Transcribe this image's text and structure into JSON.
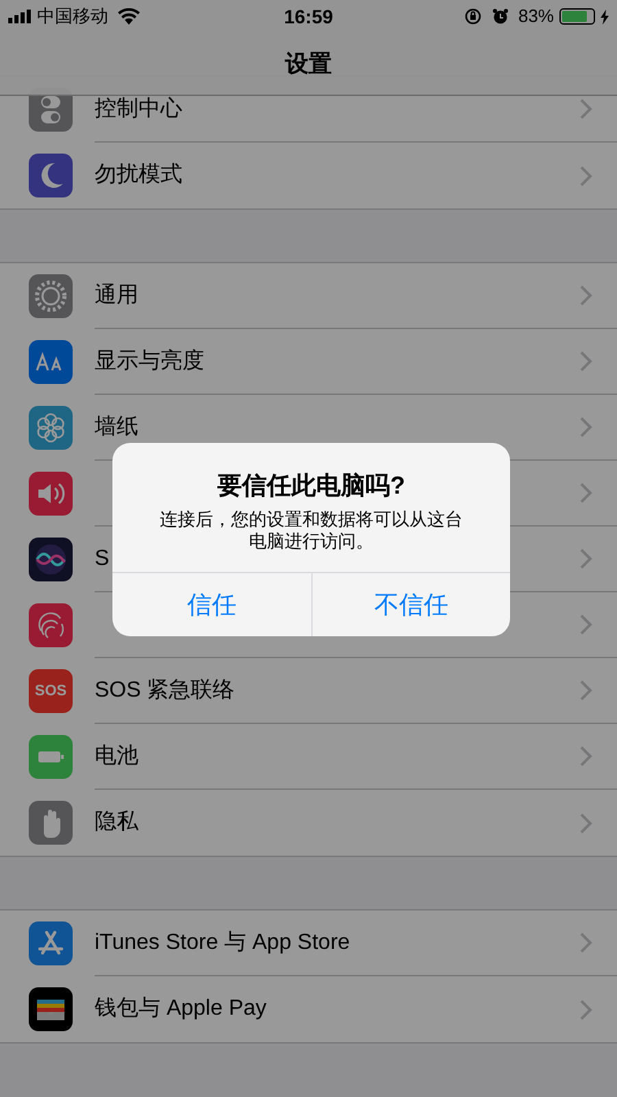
{
  "status_bar": {
    "carrier": "中国移动",
    "time": "16:59",
    "battery_percent": "83%",
    "battery": {
      "level": 0.83,
      "charging": true
    }
  },
  "nav": {
    "title": "设置"
  },
  "groups": [
    {
      "rows": [
        {
          "kind": "control",
          "label": "控制中心"
        },
        {
          "kind": "moon",
          "label": "勿扰模式"
        }
      ]
    },
    {
      "rows": [
        {
          "kind": "gear",
          "label": "通用"
        },
        {
          "kind": "display",
          "label": "显示与亮度"
        },
        {
          "kind": "flower",
          "label": "墙纸"
        },
        {
          "kind": "sound"
        },
        {
          "kind": "siri",
          "label": "S"
        },
        {
          "kind": "finger"
        },
        {
          "kind": "sos",
          "label": "SOS 紧急联络",
          "icon_text": "SOS"
        },
        {
          "kind": "battery",
          "label": "电池"
        },
        {
          "kind": "hand",
          "label": "隐私"
        }
      ]
    },
    {
      "rows": [
        {
          "kind": "store",
          "label": "iTunes Store 与 App Store"
        },
        {
          "kind": "wallet",
          "label": "钱包与 Apple Pay"
        }
      ]
    }
  ],
  "alert": {
    "title": "要信任此电脑吗?",
    "message": "连接后，您的设置和数据将可以从这台电脑进行访问。",
    "buttons": [
      "信任",
      "不信任"
    ]
  }
}
